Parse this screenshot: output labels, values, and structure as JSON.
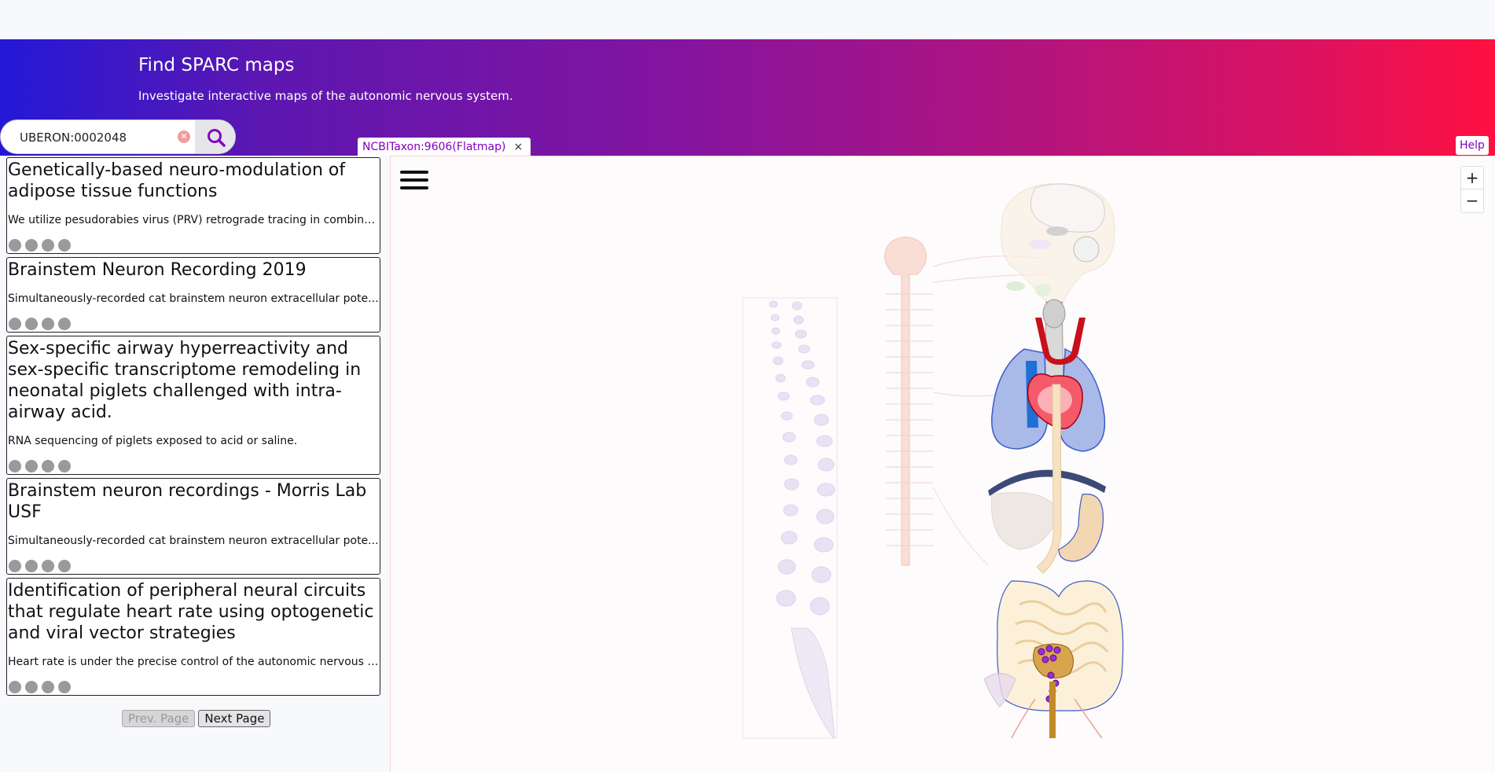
{
  "banner": {
    "title": "Find SPARC maps",
    "subtitle": "Investigate interactive maps of the autonomic nervous system."
  },
  "search": {
    "value": "UBERON:0002048",
    "clear_icon": "clear-icon",
    "search_icon": "magnifier-icon"
  },
  "tab": {
    "label": "NCBITaxon:9606(Flatmap)",
    "close_label": "×"
  },
  "help_label": "Help",
  "results": [
    {
      "title": "Genetically-based neuro-modulation of adipose tissue functions",
      "description": "We utilize pesudorabies virus (PRV) retrograde tracing in combina..."
    },
    {
      "title": "Brainstem Neuron Recording 2019",
      "description": "Simultaneously-recorded cat brainstem neuron extracellular pote..."
    },
    {
      "title": "Sex-specific airway hyperreactivity and sex-specific transcriptome remodeling in neonatal piglets challenged with intra-airway acid.",
      "description": "RNA sequencing of piglets exposed to acid or saline."
    },
    {
      "title": "Brainstem neuron recordings - Morris Lab USF",
      "description": "Simultaneously-recorded cat brainstem neuron extracellular pote..."
    },
    {
      "title": "Identification of peripheral neural circuits that regulate heart rate using optogenetic and viral vector strategies",
      "description": "Heart rate is under the precise control of the autonomic nervous s..."
    }
  ],
  "pager": {
    "prev_label": "Prev. Page",
    "next_label": "Next Page"
  },
  "map": {
    "zoom_in_label": "+",
    "zoom_out_label": "−",
    "menu_icon": "hamburger-menu-icon"
  },
  "colors": {
    "accent": "#8300bf",
    "banner_start": "#2418d6",
    "banner_end": "#ff1040",
    "lung": "#a9b9e8",
    "heart": "#e8222a",
    "intestine": "#f6e2c2"
  }
}
